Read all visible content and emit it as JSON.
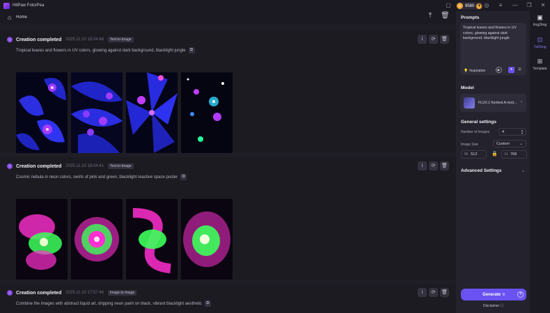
{
  "app": {
    "title": "HitPaw FotorPea",
    "credits": "9580"
  },
  "nav": {
    "home": "Home"
  },
  "cards": [
    {
      "title": "Creation completed",
      "time": "2025.11.10  18:04:48",
      "mode": "Text-to-Image",
      "prompt": "Tropical leaves and flowers in UV colors, glowing against dark background, blacklight jungle"
    },
    {
      "title": "Creation completed",
      "time": "2025.11.10  18:04:41",
      "mode": "Text-to-Image",
      "prompt": "Cosmic nebula in neon colors, swirls of pink and green, blacklight reactive space poster"
    },
    {
      "title": "Creation completed",
      "time": "2025.11.10  17:57:46",
      "mode": "Image-to-Image",
      "prompt": "Combine the images with abstract liquid art, dripping neon paint on black, vibrant blacklight aesthetic"
    }
  ],
  "sidebar": {
    "prompts_title": "Prompts",
    "prompt_value": "Tropical leaves and flowers in UV colors, glowing against dark background, blacklight jungle",
    "inspiration": "Inspiration",
    "model_title": "Model",
    "model_name": "FLUX.1 Kontext.A mod...",
    "general_title": "General settings",
    "num_images_label": "Number of Images",
    "num_images": "4",
    "image_size_label": "Image Size",
    "image_size": "Custom",
    "width_label": "W",
    "width": "512",
    "height_label": "H",
    "height": "768",
    "advanced": "Advanced Settings",
    "generate": "Generate",
    "generate_cost": "8",
    "disclaimer": "Disclaimer"
  },
  "rail": [
    {
      "label": "Img2Img",
      "icon": "image-icon"
    },
    {
      "label": "Txt2Img",
      "icon": "text-image-icon"
    },
    {
      "label": "Template",
      "icon": "template-icon"
    }
  ],
  "colors": {
    "accent": "#6a52f2",
    "background": "#1b1a22",
    "panel": "#24222c"
  }
}
